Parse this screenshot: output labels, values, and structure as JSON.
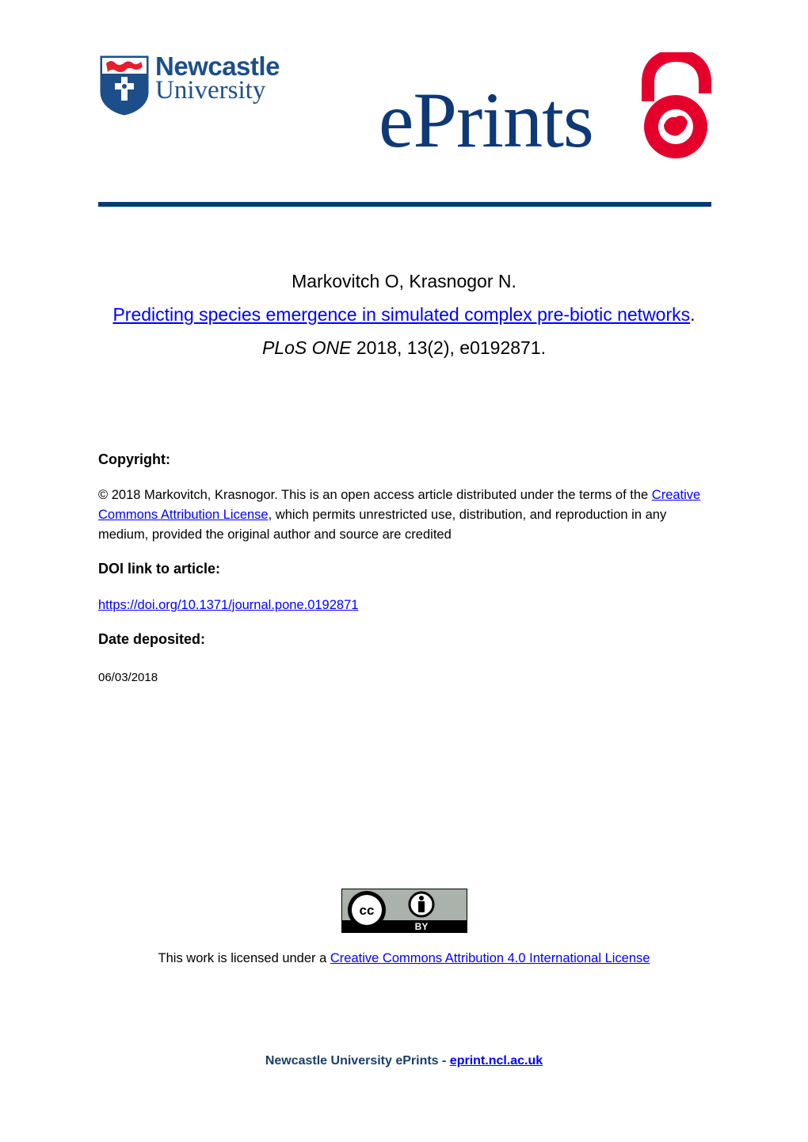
{
  "header": {
    "university_logo": {
      "line1": "Newcastle",
      "line2": "University",
      "icon": "university-shield-icon"
    },
    "repository_logo": {
      "text": "ePrints",
      "icon": "open-access-lock-icon"
    }
  },
  "citation": {
    "authors": "Markovitch O, Krasnogor N.",
    "title": "Predicting species emergence in simulated complex pre-biotic networks",
    "title_suffix": ".",
    "journal": "PLoS ONE",
    "journal_details": " 2018, 13(2), e0192871."
  },
  "sections": {
    "copyright": {
      "heading": "Copyright:",
      "text_before": "© 2018 Markovitch, Krasnogor. This is an open access article distributed under the terms of the ",
      "link_text": "Creative Commons Attribution License",
      "text_after": ", which permits unrestricted use, distribution, and reproduction in any medium, provided the original author and source are credited"
    },
    "doi": {
      "heading": "DOI link to article:",
      "link": "https://doi.org/10.1371/journal.pone.0192871"
    },
    "date": {
      "heading": "Date deposited:",
      "value": "06/03/2018"
    }
  },
  "license": {
    "badge": {
      "label": "BY",
      "icon_cc": "cc-icon",
      "icon_by": "attribution-person-icon"
    },
    "text_before": "This work is licensed under a ",
    "link_text": "Creative Commons Attribution 4.0 International License"
  },
  "footer": {
    "text": "Newcastle University ePrints - ",
    "link_text": "eprint.ncl.ac.uk"
  },
  "colors": {
    "brand_blue": "#0f3876",
    "rule": "#003a78",
    "oa_red": "#e4002b",
    "link": "#0000ff"
  }
}
